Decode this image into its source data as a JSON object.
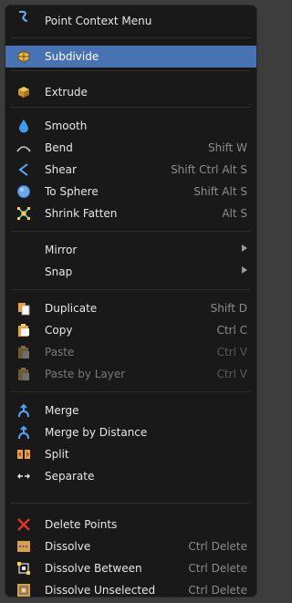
{
  "menu": {
    "title": "Point Context Menu",
    "items": [
      {
        "label": "Subdivide",
        "shortcut": ""
      },
      {
        "label": "Extrude",
        "shortcut": ""
      },
      {
        "label": "Smooth",
        "shortcut": ""
      },
      {
        "label": "Bend",
        "shortcut": "Shift W"
      },
      {
        "label": "Shear",
        "shortcut": "Shift Ctrl Alt S"
      },
      {
        "label": "To Sphere",
        "shortcut": "Shift Alt S"
      },
      {
        "label": "Shrink Fatten",
        "shortcut": "Alt S"
      },
      {
        "label": "Mirror",
        "shortcut": ""
      },
      {
        "label": "Snap",
        "shortcut": ""
      },
      {
        "label": "Duplicate",
        "shortcut": "Shift D"
      },
      {
        "label": "Copy",
        "shortcut": "Ctrl C"
      },
      {
        "label": "Paste",
        "shortcut": "Ctrl V"
      },
      {
        "label": "Paste by Layer",
        "shortcut": "Ctrl V"
      },
      {
        "label": "Merge",
        "shortcut": ""
      },
      {
        "label": "Merge by Distance",
        "shortcut": ""
      },
      {
        "label": "Split",
        "shortcut": ""
      },
      {
        "label": "Separate",
        "shortcut": ""
      },
      {
        "label": "Delete Points",
        "shortcut": ""
      },
      {
        "label": "Dissolve",
        "shortcut": "Ctrl Delete"
      },
      {
        "label": "Dissolve Between",
        "shortcut": "Ctrl Delete"
      },
      {
        "label": "Dissolve Unselected",
        "shortcut": "Ctrl Delete"
      }
    ]
  },
  "colors": {
    "menu_background": "#191919",
    "highlight": "#4772b3",
    "text": "#e6e6e6",
    "shortcut_text": "#8c8c8c",
    "disabled_text": "#7a7a7a"
  }
}
